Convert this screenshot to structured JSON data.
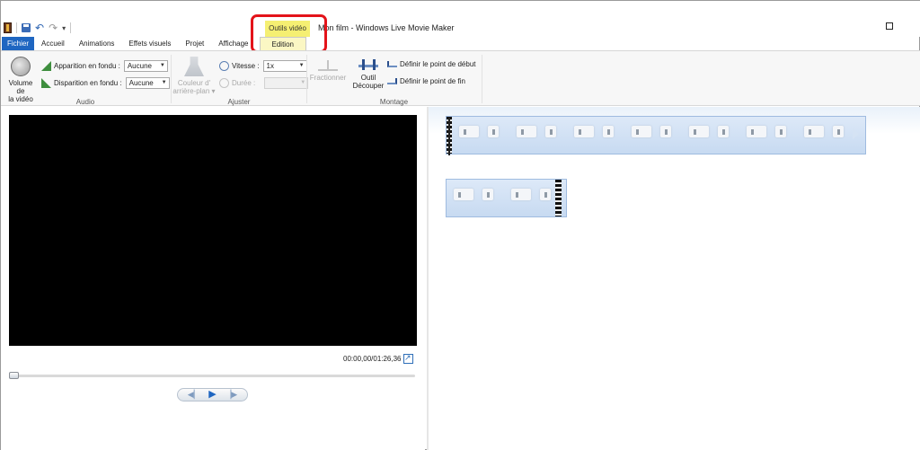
{
  "window": {
    "title": "Mon film - Windows Live Movie Maker"
  },
  "contextual": {
    "group_label": "Outils vidéo"
  },
  "tabs": [
    {
      "label": "Fichier"
    },
    {
      "label": "Accueil"
    },
    {
      "label": "Animations"
    },
    {
      "label": "Effets visuels"
    },
    {
      "label": "Projet"
    },
    {
      "label": "Affichage"
    },
    {
      "label": "Edition"
    }
  ],
  "ribbon": {
    "audio": {
      "label": "Audio",
      "volume_label_1": "Volume de",
      "volume_label_2": "la vidéo",
      "fade_in_label": "Apparition en fondu :",
      "fade_in_value": "Aucune",
      "fade_out_label": "Disparition en fondu :",
      "fade_out_value": "Aucune"
    },
    "adjust": {
      "label": "Ajuster",
      "bg_color_1": "Couleur d'",
      "bg_color_2": "arrière-plan ▾",
      "speed_label": "Vitesse :",
      "speed_value": "1x",
      "duration_label": "Durée :",
      "duration_value": ""
    },
    "montage": {
      "label": "Montage",
      "split_label": "Fractionner",
      "trim_label_1": "Outil",
      "trim_label_2": "Découper",
      "set_start": "Définir le point de début",
      "set_end": "Définir le point de fin"
    }
  },
  "preview": {
    "timecode": "00:00,00/01:26,36",
    "seek_progress": 0.0
  },
  "colors": {
    "file_tab": "#1f66c1",
    "contextual_tab": "#f5ef72",
    "highlight_box": "#e3131a",
    "clip_strip": "#c7daf1"
  }
}
